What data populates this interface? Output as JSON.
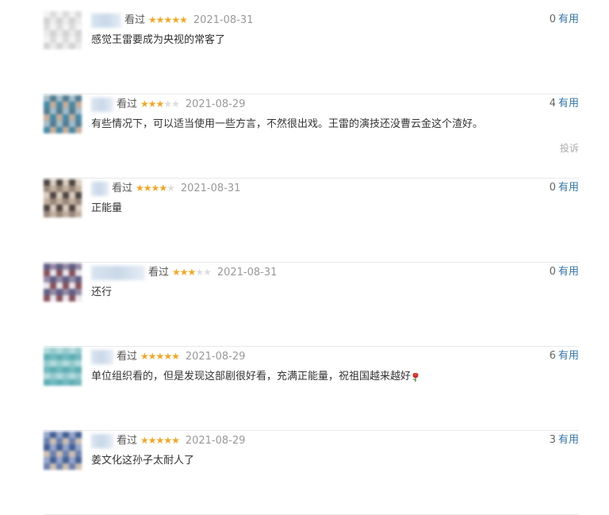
{
  "comments": [
    {
      "watched": "看过",
      "rating": 5,
      "date": "2021-08-31",
      "votes": "0",
      "useful_label": "有用",
      "text": "感觉王雷要成为央视的常客了",
      "avatar_colors": [
        "#f2f2f2",
        "#e9e9e9",
        "#d9d9d9",
        "#cfcfcf"
      ],
      "username_width": 38
    },
    {
      "watched": "看过",
      "rating": 3,
      "date": "2021-08-29",
      "votes": "4",
      "useful_label": "有用",
      "text": "有些情况下，可以适当使用一些方言，不然很出戏。王雷的演技还没曹云金这个渣好。",
      "report": "投诉",
      "avatar_colors": [
        "#2f7f9f",
        "#9ab6c4",
        "#c5a48e",
        "#3f6f88"
      ],
      "username_width": 28
    },
    {
      "watched": "看过",
      "rating": 4,
      "date": "2021-08-31",
      "votes": "0",
      "useful_label": "有用",
      "text": "正能量",
      "avatar_colors": [
        "#d7c8b9",
        "#8d7a6c",
        "#3a302b",
        "#bca894"
      ],
      "username_width": 22
    },
    {
      "watched": "看过",
      "rating": 3,
      "date": "2021-08-31",
      "votes": "0",
      "useful_label": "有用",
      "text": "还行",
      "avatar_colors": [
        "#e8e6ee",
        "#8a7f99",
        "#7b3f4a",
        "#4e4d78"
      ],
      "username_width": 68
    },
    {
      "watched": "看过",
      "rating": 5,
      "date": "2021-08-29",
      "votes": "6",
      "useful_label": "有用",
      "text": "单位组织看的，但是发现这部剧很好看，充满正能量，祝祖国越来越好",
      "emoji": "rose",
      "avatar_colors": [
        "#a9d6d9",
        "#62b3b8",
        "#8cc7c9",
        "#4ea6ad"
      ],
      "username_width": 28
    },
    {
      "watched": "看过",
      "rating": 5,
      "date": "2021-08-29",
      "votes": "3",
      "useful_label": "有用",
      "text": "姜文化这孙子太耐人了",
      "avatar_colors": [
        "#5b74a8",
        "#8a9cc4",
        "#c8b8a8",
        "#2f4f8a"
      ],
      "username_width": 28
    }
  ]
}
